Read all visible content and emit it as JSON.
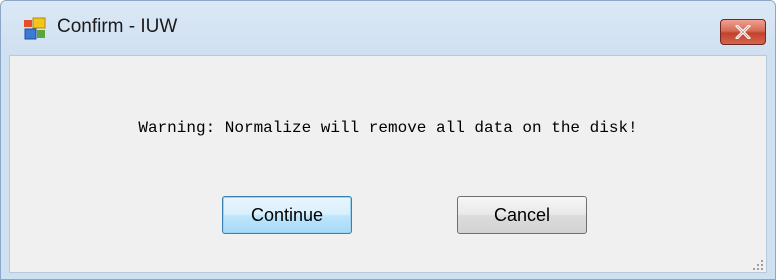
{
  "window": {
    "title": "Confirm - IUW",
    "icon": "app-window-icon",
    "close_icon": "close-icon"
  },
  "dialog": {
    "message": "Warning: Normalize will remove all data on the disk!",
    "buttons": {
      "continue_label": "Continue",
      "cancel_label": "Cancel"
    }
  },
  "colors": {
    "frame": "#cfe0f1",
    "client_background": "#f0f0f0",
    "close_button": "#c2412d",
    "default_button_border": "#3c7fb1"
  }
}
